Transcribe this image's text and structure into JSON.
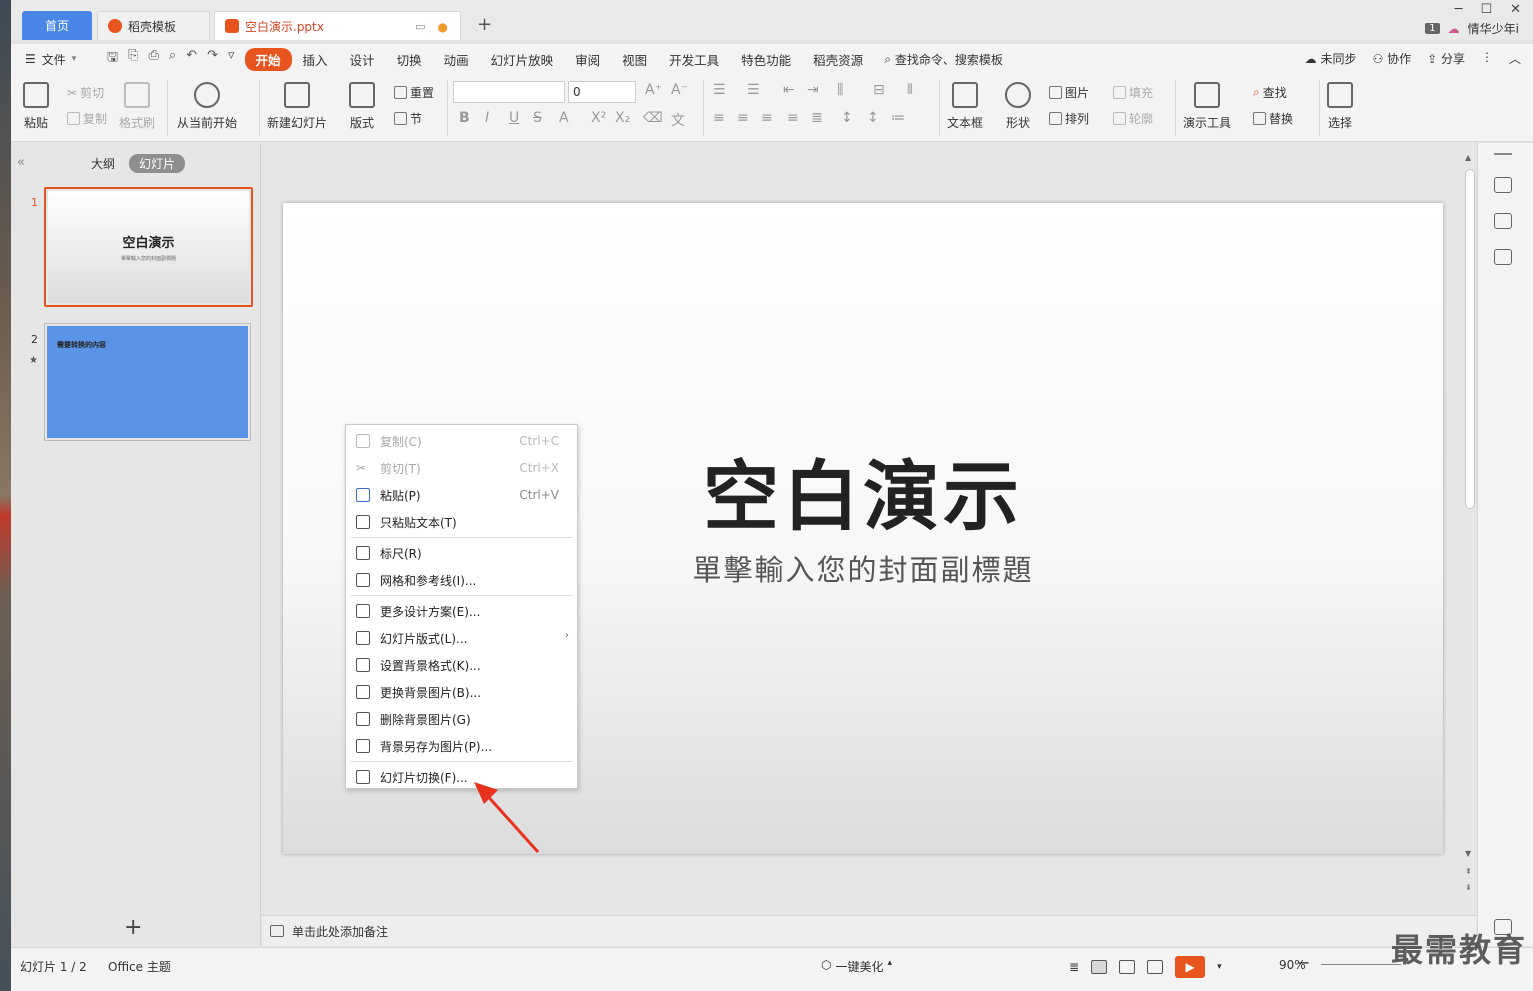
{
  "tabs": {
    "home": "首页",
    "template": "稻壳模板",
    "document": "空白演示.pptx",
    "add": "+"
  },
  "titlebar": {
    "badge": "1",
    "user": "情华少年i",
    "minimize": "─",
    "maximize": "☐",
    "close": "✕"
  },
  "menu": {
    "file": "文件",
    "tabs": [
      "开始",
      "插入",
      "设计",
      "切换",
      "动画",
      "幻灯片放映",
      "审阅",
      "视图",
      "开发工具",
      "特色功能",
      "稻壳资源"
    ],
    "search": "查找命令、搜索模板",
    "sync": "未同步",
    "collab": "协作",
    "share": "分享"
  },
  "ribbon": {
    "paste": "粘贴",
    "cut": "剪切",
    "copy": "复制",
    "format_painter": "格式刷",
    "from_current": "从当前开始",
    "new_slide": "新建幻灯片",
    "layout": "版式",
    "reset": "重置",
    "section": "节",
    "font_size": "0",
    "textbox": "文本框",
    "shape": "形状",
    "picture": "图片",
    "arrange": "排列",
    "fill": "填充",
    "outline": "轮廓",
    "present_tools": "演示工具",
    "find": "查找",
    "replace": "替换",
    "select": "选择"
  },
  "leftpanel": {
    "outline": "大纲",
    "slides": "幻灯片",
    "thumb1_num": "1",
    "thumb1_title": "空白演示",
    "thumb1_sub": "單擊輸入您的封面副標題",
    "thumb2_num": "2",
    "thumb2_text": "需要转换的内容",
    "add": "+"
  },
  "slide": {
    "title": "空白演示",
    "subtitle": "單擊輸入您的封面副標題"
  },
  "context_menu": [
    {
      "label": "复制(C)",
      "key": "Ctrl+C",
      "disabled": true
    },
    {
      "label": "剪切(T)",
      "key": "Ctrl+X",
      "disabled": true
    },
    {
      "label": "粘贴(P)",
      "key": "Ctrl+V",
      "disabled": false
    },
    {
      "label": "只粘贴文本(T)",
      "key": "",
      "disabled": false
    },
    {
      "label": "标尺(R)",
      "key": "",
      "disabled": false
    },
    {
      "label": "网格和参考线(I)...",
      "key": "",
      "disabled": false
    },
    {
      "label": "更多设计方案(E)...",
      "key": "",
      "disabled": false
    },
    {
      "label": "幻灯片版式(L)...",
      "key": "",
      "disabled": false
    },
    {
      "label": "设置背景格式(K)...",
      "key": "",
      "disabled": false
    },
    {
      "label": "更换背景图片(B)...",
      "key": "",
      "disabled": false
    },
    {
      "label": "删除背景图片(G)",
      "key": "",
      "disabled": false
    },
    {
      "label": "背景另存为图片(P)...",
      "key": "",
      "disabled": false
    },
    {
      "label": "幻灯片切换(F)...",
      "key": "",
      "disabled": false
    }
  ],
  "notes": "单击此处添加备注",
  "status": {
    "slide": "幻灯片 1 / 2",
    "theme": "Office 主题",
    "beautify": "一键美化",
    "zoom": "90%",
    "watermark": "最需教育"
  },
  "colors": {
    "accent": "#e8541e",
    "tab_blue": "#4a86e8",
    "slide2_bg": "#5b94e6"
  }
}
